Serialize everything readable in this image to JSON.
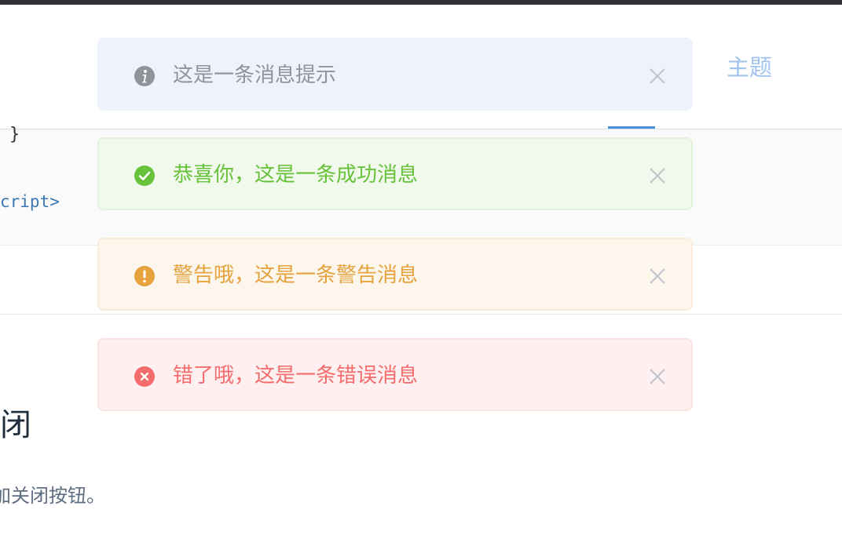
{
  "header": {
    "theme_link": "主题"
  },
  "code": {
    "brace": "}",
    "script_tag": "cript>"
  },
  "section": {
    "title_fragment": "闭",
    "desc_prefix": "加",
    "desc_rest": "关闭按钮。"
  },
  "messages": [
    {
      "type": "info",
      "text": "这是一条消息提示",
      "icon": "info-icon",
      "color": "#909399"
    },
    {
      "type": "success",
      "text": "恭喜你，这是一条成功消息",
      "icon": "success-icon",
      "color": "#67c23a"
    },
    {
      "type": "warning",
      "text": "警告哦，这是一条警告消息",
      "icon": "warning-icon",
      "color": "#e6a23c"
    },
    {
      "type": "error",
      "text": "错了哦，这是一条错误消息",
      "icon": "error-icon",
      "color": "#f56c6c"
    }
  ],
  "colors": {
    "link": "#a3c4ee",
    "tab_active": "#4a90e2",
    "close": "#c0c4cc"
  }
}
